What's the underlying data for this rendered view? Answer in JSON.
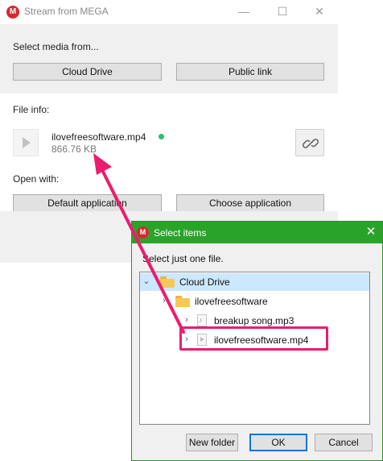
{
  "window": {
    "title": "Stream from MEGA",
    "logo": "M",
    "minimize": "—",
    "maximize": "☐",
    "close": "✕"
  },
  "select_media": {
    "label": "Select media from...",
    "cloud_drive_button": "Cloud Drive",
    "public_link_button": "Public link"
  },
  "file_info": {
    "label": "File info:",
    "file_name": "ilovefreesoftware.mp4",
    "file_size": "866.76 KB",
    "status_color": "#22c55e",
    "link_icon": "link-icon"
  },
  "open_with": {
    "label": "Open with:",
    "default_app_button": "Default application",
    "choose_app_button": "Choose application"
  },
  "dialog": {
    "title": "Select items",
    "logo": "M",
    "close": "✕",
    "instruction": "Select just one file.",
    "tree": {
      "root": "Cloud Drive",
      "folder": "ilovefreesoftware",
      "file1": "breakup song.mp3",
      "file2": "ilovefreesoftware.mp4",
      "expanded_glyph": "⌄",
      "collapsed_glyph": "›"
    },
    "buttons": {
      "new_folder": "New folder",
      "ok": "OK",
      "cancel": "Cancel"
    }
  },
  "colors": {
    "accent_green": "#2aa32a",
    "mega_red": "#d9272e",
    "annotation_pink": "#ea1d6e",
    "selection_blue": "#cce8ff"
  }
}
